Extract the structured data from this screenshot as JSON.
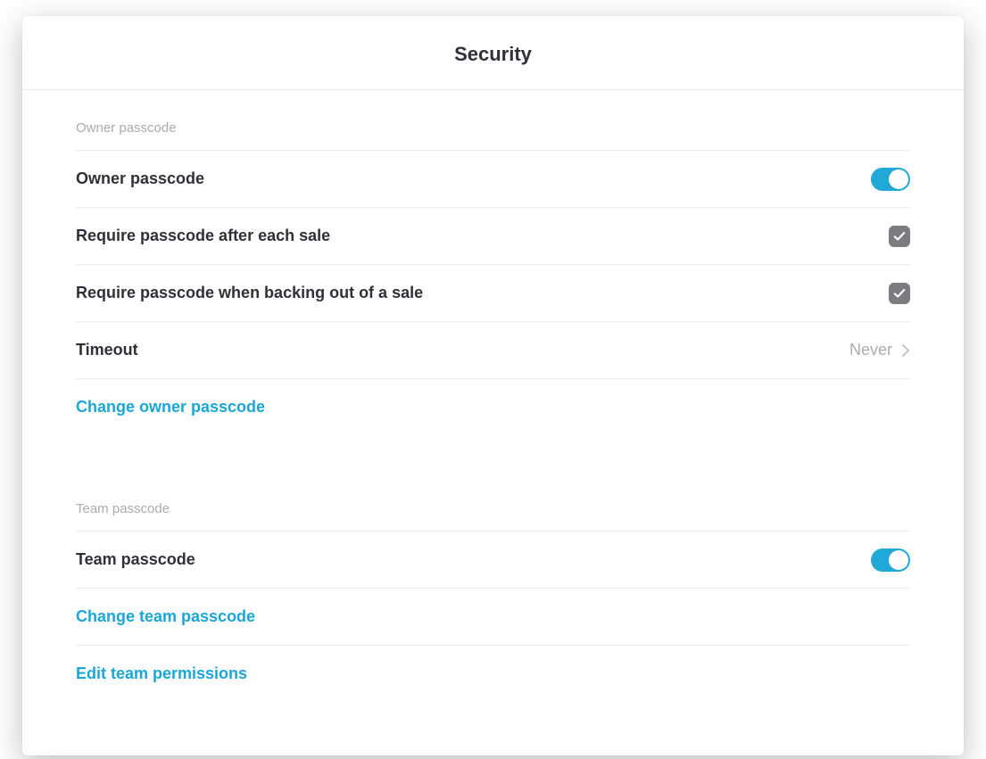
{
  "header": {
    "title": "Security"
  },
  "sections": {
    "owner": {
      "label": "Owner passcode",
      "rows": {
        "owner_passcode": {
          "label": "Owner passcode",
          "on": true
        },
        "require_after_sale": {
          "label": "Require passcode after each sale",
          "checked": true
        },
        "require_back_out": {
          "label": "Require passcode when backing out of a sale",
          "checked": true
        },
        "timeout": {
          "label": "Timeout",
          "value": "Never"
        },
        "change_owner": {
          "label": "Change owner passcode"
        }
      }
    },
    "team": {
      "label": "Team passcode",
      "rows": {
        "team_passcode": {
          "label": "Team passcode",
          "on": true
        },
        "change_team": {
          "label": "Change team passcode"
        },
        "edit_perms": {
          "label": "Edit team permissions"
        }
      }
    }
  }
}
